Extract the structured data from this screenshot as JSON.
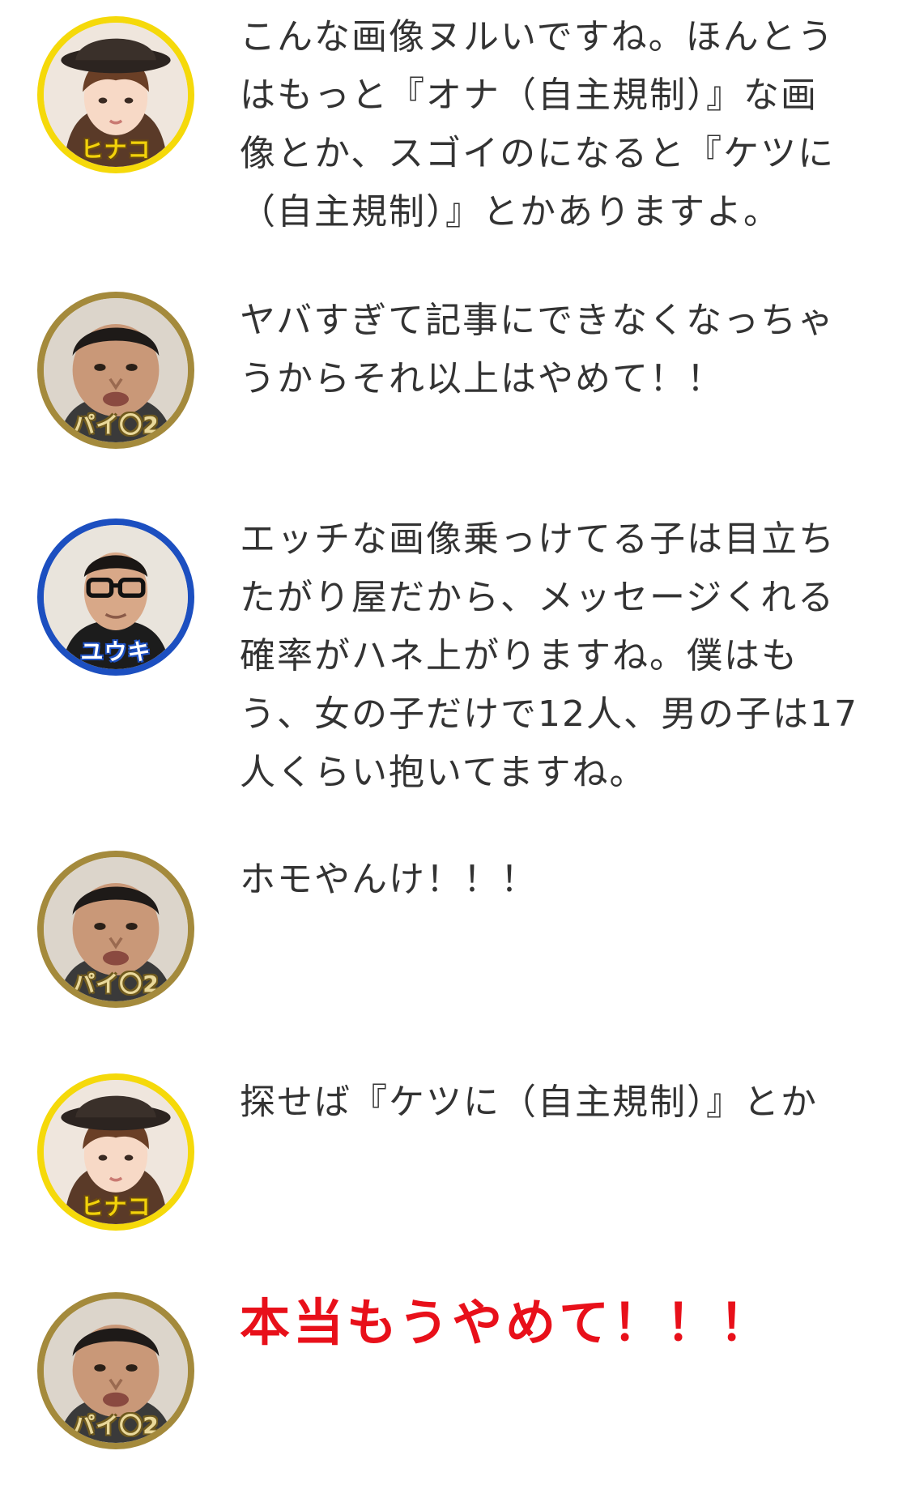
{
  "messages": [
    {
      "speaker": "ヒナコ",
      "ring_color": "#f5d90a",
      "text": "こんな画像ヌルいですね。ほんとう\nはもっと『オナ（自主規制）』な画\n像とか、スゴイのになると『ケツに\n（自主規制）』とかありますよ。",
      "emphasis": false
    },
    {
      "speaker": "パイ〇2",
      "ring_color": "#a48a3c",
      "text": "ヤバすぎて記事にできなくなっちゃ\nうからそれ以上はやめて！！",
      "emphasis": false
    },
    {
      "speaker": "ユウキ",
      "ring_color": "#1c4fc0",
      "text": "エッチな画像乗っけてる子は目立ち\nたがり屋だから、メッセージくれる\n確率がハネ上がりますね。僕はも\nう、女の子だけで12人、男の子は17\n人くらい抱いてますね。",
      "emphasis": false
    },
    {
      "speaker": "パイ〇2",
      "ring_color": "#a48a3c",
      "text": "ホモやんけ！！！",
      "emphasis": false
    },
    {
      "speaker": "ヒナコ",
      "ring_color": "#f5d90a",
      "text": "探せば『ケツに（自主規制）』とか",
      "emphasis": false
    },
    {
      "speaker": "パイ〇2",
      "ring_color": "#a48a3c",
      "text": "本当もうやめて！！！",
      "emphasis": true,
      "emphasis_color": "#e8101a"
    }
  ]
}
